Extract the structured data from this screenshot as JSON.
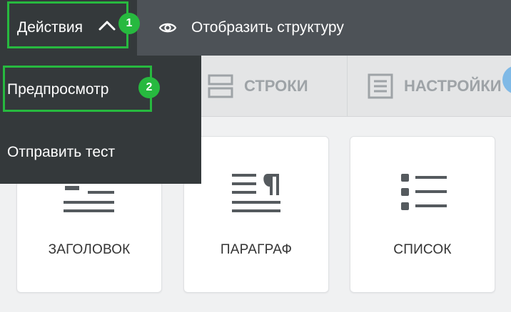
{
  "toolbar": {
    "actions_label": "Действия",
    "actions_icon": "chevron-up-icon",
    "show_structure_label": "Отобразить структуру",
    "show_structure_icon": "eye-icon"
  },
  "tabs": [
    {
      "label": "СТРОКИ",
      "icon": "rows-icon"
    },
    {
      "label": "НАСТРОЙКИ",
      "icon": "settings-doc-icon"
    }
  ],
  "dropdown": {
    "items": [
      {
        "label": "Предпросмотр"
      },
      {
        "label": "Отправить тест"
      }
    ]
  },
  "cards": [
    {
      "label": "ЗАГОЛОВОК",
      "icon": "heading-icon"
    },
    {
      "label": "ПАРАГРАФ",
      "icon": "paragraph-icon"
    },
    {
      "label": "СПИСОК",
      "icon": "list-icon"
    }
  ],
  "annotations": [
    {
      "number": "1"
    },
    {
      "number": "2"
    }
  ],
  "colors": {
    "toolbar_bg": "#4d5257",
    "dropdown_bg": "#34393b",
    "highlight": "#27b93f",
    "tab_text": "#9ea3a7",
    "icon_gray": "#555a5e"
  }
}
